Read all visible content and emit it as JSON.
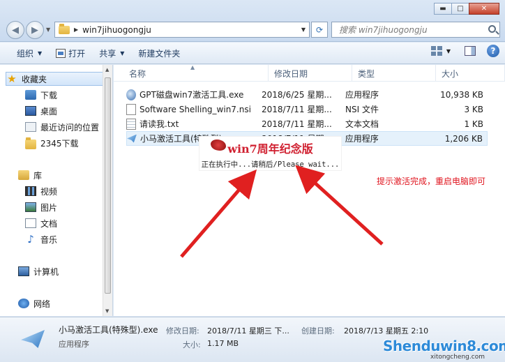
{
  "window": {
    "controls": {
      "minimize": "▬",
      "maximize": "□",
      "close": "✕"
    }
  },
  "address": {
    "path": "win7jihuogongju",
    "search_placeholder": "搜索 win7jihuogongju"
  },
  "toolbar": {
    "organize": "组织",
    "open": "打开",
    "share": "共享",
    "new_folder": "新建文件夹"
  },
  "navpane": {
    "favorites": "收藏夹",
    "downloads": "下载",
    "desktop": "桌面",
    "recent": "最近访问的位置",
    "downloads_2345": "2345下载",
    "libraries": "库",
    "videos": "视频",
    "pictures": "图片",
    "documents": "文档",
    "music": "音乐",
    "computer": "计算机",
    "network": "网络"
  },
  "columns": {
    "name": "名称",
    "date": "修改日期",
    "type": "类型",
    "size": "大小"
  },
  "files": [
    {
      "name": "GPT磁盘win7激活工具.exe",
      "date": "2018/6/25 星期...",
      "type": "应用程序",
      "size": "10,938 KB",
      "icon": "exe-icon"
    },
    {
      "name": "Software Shelling_win7.nsi",
      "date": "2018/7/11 星期...",
      "type": "NSI 文件",
      "size": "3 KB",
      "icon": "nsi-file-icon"
    },
    {
      "name": "请读我.txt",
      "date": "2018/7/11 星期...",
      "type": "文本文档",
      "size": "1 KB",
      "icon": "text-file-icon"
    },
    {
      "name": "小马激活工具(特殊型).exe",
      "date": "2018/7/11 星期...",
      "type": "应用程序",
      "size": "1,206 KB",
      "icon": "paper-plane-icon"
    }
  ],
  "popup": {
    "title": "win7周年纪念版",
    "message": "正在执行中...请稍后/Please wait..."
  },
  "annotation": "提示激活完成，重启电脑即可",
  "details": {
    "name": "小马激活工具(特殊型).exe",
    "kind": "应用程序",
    "modified_label": "修改日期:",
    "modified_value": "2018/7/11 星期三 下...",
    "created_label": "创建日期:",
    "created_value": "2018/7/13 星期五 2:10",
    "size_label": "大小:",
    "size_value": "1.17 MB"
  },
  "watermark": {
    "brand": "Shenduwin8.com",
    "sub": "xitongcheng.com"
  },
  "colors": {
    "annotation": "#e0141e",
    "arrow": "#e02020",
    "selection": "#e5f1fb"
  }
}
